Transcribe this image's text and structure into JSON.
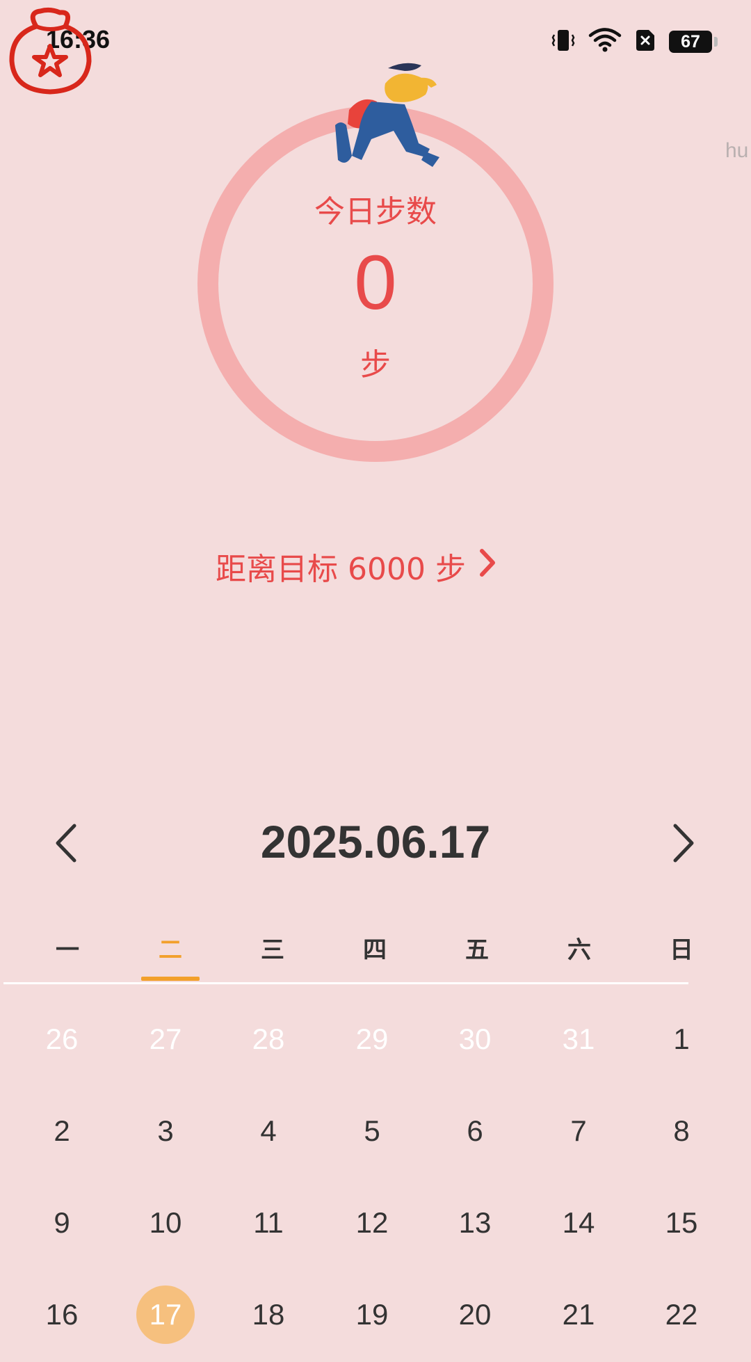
{
  "status_bar": {
    "time": "16:36",
    "battery": "67",
    "icons": [
      "vibrate-icon",
      "wifi-icon",
      "sim-disabled-icon",
      "battery-icon"
    ]
  },
  "app": {
    "logo_icon": "lucky-bag-star-icon",
    "side_hint": "hu"
  },
  "steps": {
    "label": "今日步数",
    "count": "0",
    "unit": "步",
    "illustration": "runner-icon",
    "ring_color": "#f4aeae",
    "text_color": "#e84a4a"
  },
  "goal": {
    "text": "距离目标 6000 步",
    "arrow_icon": "chevron-right-icon"
  },
  "calendar": {
    "date": "2025.06.17",
    "prev_icon": "chevron-left-icon",
    "next_icon": "chevron-right-icon",
    "weekdays": [
      "一",
      "二",
      "三",
      "四",
      "五",
      "六",
      "日"
    ],
    "active_weekday_index": 1,
    "accent_color": "#f2a02b",
    "today_color": "#f6c07e",
    "weeks": [
      [
        {
          "day": "26",
          "muted": true
        },
        {
          "day": "27",
          "muted": true
        },
        {
          "day": "28",
          "muted": true
        },
        {
          "day": "29",
          "muted": true
        },
        {
          "day": "30",
          "muted": true
        },
        {
          "day": "31",
          "muted": true
        },
        {
          "day": "1",
          "muted": false
        }
      ],
      [
        {
          "day": "2",
          "muted": false
        },
        {
          "day": "3",
          "muted": false
        },
        {
          "day": "4",
          "muted": false
        },
        {
          "day": "5",
          "muted": false
        },
        {
          "day": "6",
          "muted": false
        },
        {
          "day": "7",
          "muted": false
        },
        {
          "day": "8",
          "muted": false
        }
      ],
      [
        {
          "day": "9",
          "muted": false
        },
        {
          "day": "10",
          "muted": false
        },
        {
          "day": "11",
          "muted": false
        },
        {
          "day": "12",
          "muted": false
        },
        {
          "day": "13",
          "muted": false
        },
        {
          "day": "14",
          "muted": false
        },
        {
          "day": "15",
          "muted": false
        }
      ],
      [
        {
          "day": "16",
          "muted": false
        },
        {
          "day": "17",
          "muted": false,
          "today": true
        },
        {
          "day": "18",
          "muted": false
        },
        {
          "day": "19",
          "muted": false
        },
        {
          "day": "20",
          "muted": false
        },
        {
          "day": "21",
          "muted": false
        },
        {
          "day": "22",
          "muted": false
        }
      ]
    ]
  }
}
